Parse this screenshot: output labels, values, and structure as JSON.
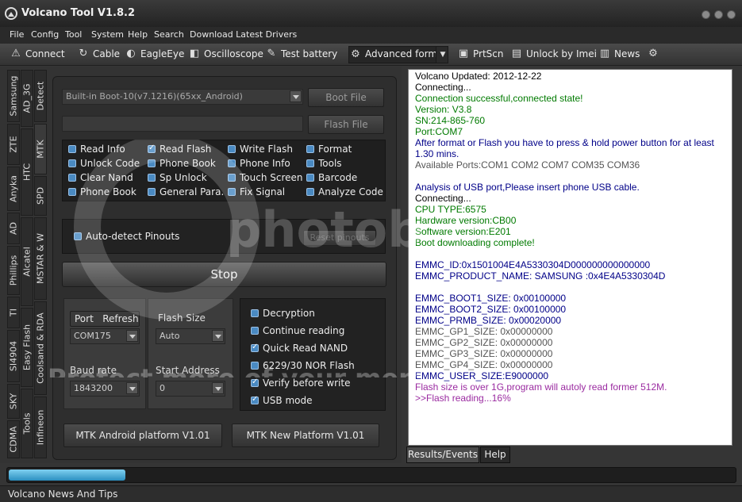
{
  "window": {
    "title": "Volcano Tool V1.8.2"
  },
  "menu": [
    "File",
    "Config",
    "Tool",
    "System",
    "Help",
    "Search",
    "Download Latest Drivers"
  ],
  "toolbar": {
    "connect": "Connect",
    "cable": "Cable",
    "eagleeye": "EagleEye",
    "oscilloscope": "Oscilloscope",
    "test_battery": "Test battery",
    "advanced_form": "Advanced form",
    "prtscn": "PrtScn",
    "unlock_imei": "Unlock by Imei",
    "news": "News"
  },
  "left_tabs": {
    "col1": [
      "Samsung",
      "ZTE",
      "Anyka",
      "AD",
      "Phillips",
      "TI",
      "SI4904",
      "SKY",
      "CDMA"
    ],
    "col2": [
      "AD_3G",
      "HTC",
      "Alcatel",
      "Easy Flash",
      "Tools"
    ],
    "col3": [
      "Detect",
      "MTK",
      "SPD",
      "MSTAR & W",
      "Coolsand & RDA",
      "Infineon"
    ]
  },
  "boot": {
    "combo_value": "Built-in Boot-10(v7.1216)(65xx_Android)",
    "boot_file": "Boot File",
    "flash_file": "Flash File"
  },
  "checks": [
    {
      "label": "Read Info",
      "checked": false
    },
    {
      "label": "Read Flash",
      "checked": true
    },
    {
      "label": "Write Flash",
      "checked": false
    },
    {
      "label": "Format",
      "checked": false
    },
    {
      "label": "Unlock Code",
      "checked": false
    },
    {
      "label": "Phone Book",
      "checked": false
    },
    {
      "label": "Phone Info",
      "checked": false
    },
    {
      "label": "Tools",
      "checked": false
    },
    {
      "label": "Clear Nand",
      "checked": false
    },
    {
      "label": "Sp Unlock",
      "checked": false
    },
    {
      "label": "Touch Screen",
      "checked": false
    },
    {
      "label": "Barcode",
      "checked": false
    },
    {
      "label": "Phone Book",
      "checked": false
    },
    {
      "label": "General Para.",
      "checked": false
    },
    {
      "label": "Fix Signal",
      "checked": false
    },
    {
      "label": "Analyze Code",
      "checked": false
    }
  ],
  "pinouts": {
    "auto_detect": "Auto-detect Pinouts",
    "reset": "Reset pinouts"
  },
  "stop_label": "Stop",
  "port": {
    "port_label": "Port",
    "refresh_label": "Refresh",
    "port_value": "COM175",
    "flash_size_label": "Flash Size",
    "flash_size_value": "Auto",
    "baud_label": "Baud rate",
    "baud_value": "1843200",
    "start_addr_label": "Start Address",
    "start_addr_value": "0"
  },
  "options": [
    {
      "label": "Decryption",
      "checked": false
    },
    {
      "label": "Continue reading",
      "checked": false
    },
    {
      "label": "Quick Read NAND",
      "checked": true
    },
    {
      "label": "6229/30 NOR Flash",
      "checked": false
    },
    {
      "label": "Verify before write",
      "checked": true
    },
    {
      "label": "USB mode",
      "checked": true
    }
  ],
  "platform_buttons": {
    "android": "MTK Android platform V1.01",
    "new": "MTK New Platform V1.01"
  },
  "log": [
    {
      "text": "Volcano Updated: 2012-12-22",
      "color": "#000000"
    },
    {
      "text": "Connecting...",
      "color": "#000000"
    },
    {
      "text": "Connection successful,connected state!",
      "color": "#007a00"
    },
    {
      "text": "Version: V3.8",
      "color": "#007a00"
    },
    {
      "text": "SN:214-865-760",
      "color": "#007a00"
    },
    {
      "text": "Port:COM7",
      "color": "#007a00"
    },
    {
      "text": "After format or Flash you have to press & hold power button for at least",
      "color": "#000088"
    },
    {
      "text": "1.30 mins.",
      "color": "#000088"
    },
    {
      "text": "Available Ports:COM1 COM2 COM7 COM35 COM36",
      "color": "#555555"
    },
    {
      "text": "",
      "color": "#000000"
    },
    {
      "text": "Analysis of USB port,Please insert phone USB cable.",
      "color": "#000088"
    },
    {
      "text": "Connecting...",
      "color": "#000000"
    },
    {
      "text": "CPU TYPE:6575",
      "color": "#007a00"
    },
    {
      "text": "Hardware version:CB00",
      "color": "#007a00"
    },
    {
      "text": "Software version:E201",
      "color": "#007a00"
    },
    {
      "text": "Boot downloading complete!",
      "color": "#007a00"
    },
    {
      "text": "",
      "color": "#000000"
    },
    {
      "text": "EMMC_ID:0x1501004E4A5330304D000000000000000",
      "color": "#000088"
    },
    {
      "text": "EMMC_PRODUCT_NAME: SAMSUNG :0x4E4A5330304D",
      "color": "#000088"
    },
    {
      "text": "",
      "color": "#000000"
    },
    {
      "text": "EMMC_BOOT1_SIZE: 0x00100000",
      "color": "#000088"
    },
    {
      "text": "EMMC_BOOT2_SIZE: 0x00100000",
      "color": "#000088"
    },
    {
      "text": "EMMC_PRMB_SIZE: 0x00020000",
      "color": "#000088"
    },
    {
      "text": "EMMC_GP1_SIZE: 0x00000000",
      "color": "#555555"
    },
    {
      "text": "EMMC_GP2_SIZE: 0x00000000",
      "color": "#555555"
    },
    {
      "text": "EMMC_GP3_SIZE: 0x00000000",
      "color": "#555555"
    },
    {
      "text": "EMMC_GP4_SIZE: 0x00000000",
      "color": "#555555"
    },
    {
      "text": "EMMC_USER_SIZE:E9000000",
      "color": "#000088"
    },
    {
      "text": "Flash size is over 1G,program will autoly read former 512M.",
      "color": "#9a2aa0"
    },
    {
      "text": ">>Flash reading...16%",
      "color": "#9a2aa0"
    }
  ],
  "log_tabs": {
    "results": "Results/Events",
    "help": "Help"
  },
  "progress": {
    "percent": 16
  },
  "status": "Volcano News And Tips",
  "watermark": {
    "brand": "photobucket",
    "caption": "Protect more of your memories for less!"
  }
}
